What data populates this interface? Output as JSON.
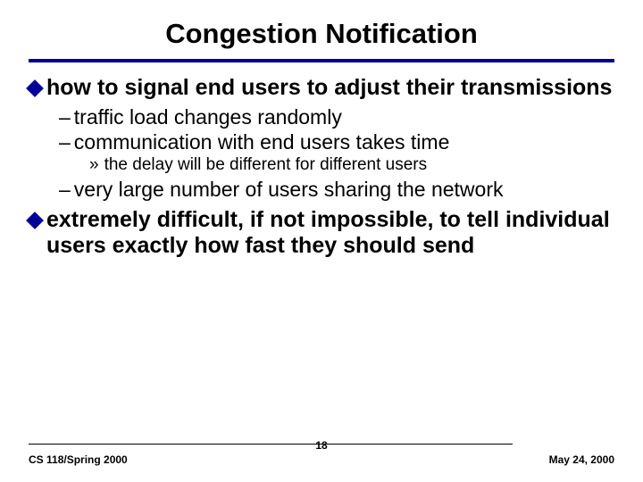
{
  "title": "Congestion Notification",
  "bullets": {
    "b1_lead": "how",
    "b1_rest": " to signal end users to adjust their transmissions",
    "b1a": "traffic load changes randomly",
    "b1b": "communication with end users takes time",
    "b1b1": "the delay will be different for different users",
    "b1c": "very large number of users sharing the network",
    "b2_lead": "extremely",
    "b2_rest": " difficult, if not impossible, to tell individual users exactly how fast they should send"
  },
  "footer": {
    "left": "CS 118/Spring 2000",
    "center": "18",
    "right": "May 24, 2000"
  }
}
